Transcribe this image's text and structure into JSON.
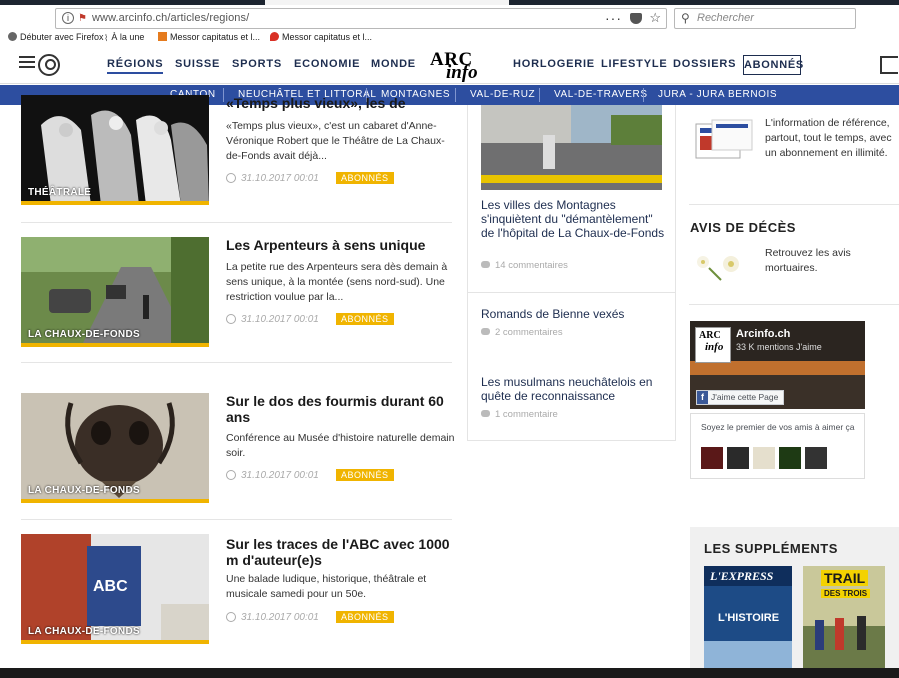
{
  "browser": {
    "url": "www.arcinfo.ch/articles/regions/",
    "search_placeholder": "Rechercher",
    "bookmarks": [
      "Débuter avec Firefox",
      "À la une",
      "Messor capitatus et l...",
      "Messor capitatus et l..."
    ]
  },
  "site": {
    "logo_top": "ARC",
    "logo_bottom": "info",
    "nav": [
      "RÉGIONS",
      "SUISSE",
      "SPORTS",
      "ECONOMIE",
      "MONDE",
      "HORLOGERIE",
      "LIFESTYLE",
      "DOSSIERS"
    ],
    "nav_active": "RÉGIONS",
    "subscribers_label": "ABONNÉS",
    "subnav": [
      "CANTON",
      "NEUCHÂTEL ET LITTORAL",
      "MONTAGNES",
      "VAL-DE-RUZ",
      "VAL-DE-TRAVERS",
      "JURA - JURA BERNOIS"
    ]
  },
  "articles": [
    {
      "tag": "THÉÂTRALE",
      "title": "«Temps plus vieux», les de",
      "excerpt": "«Temps plus vieux», c'est un cabaret d'Anne-Véronique Robert que le Théâtre de La Chaux-de-Fonds avait déjà...",
      "date": "31.10.2017 00:01",
      "badge": "ABONNÉS"
    },
    {
      "tag": "LA CHAUX-DE-FONDS",
      "title": "Les Arpenteurs à sens unique",
      "excerpt": "La petite rue des Arpenteurs sera dès demain à sens unique, à la montée (sens nord-sud). Une restriction voulue par la...",
      "date": "31.10.2017 00:01",
      "badge": "ABONNÉS"
    },
    {
      "tag": "LA CHAUX-DE-FONDS",
      "title": "Sur le dos des fourmis durant 60 ans",
      "excerpt": "Conférence au Musée d'histoire naturelle demain soir.",
      "date": "31.10.2017 00:01",
      "badge": "ABONNÉS"
    },
    {
      "tag": "LA CHAUX-DE-FONDS",
      "title": "Sur les traces de l'ABC avec 1000 m d'auteur(e)s",
      "excerpt": "Une balade ludique, historique, théâtrale et musicale samedi pour un 50e.",
      "date": "31.10.2017 00:01",
      "badge": "ABONNÉS"
    }
  ],
  "most_read": [
    {
      "title": "Les villes des Montagnes s'inquiètent du \"démantèlement\" de l'hôpital de La Chaux-de-Fonds",
      "comments": "14 commentaires"
    },
    {
      "title": "Romands de Bienne vexés",
      "comments": "2 commentaires"
    },
    {
      "title": "Les musulmans neuchâtelois en quête de reconnaissance",
      "comments": "1 commentaire"
    }
  ],
  "sidebar": {
    "promo_text": "L'information de référence, partout, tout le temps, avec un abonnement en illimité.",
    "deaths_heading": "AVIS DE DÉCÈS",
    "deaths_text": "Retrouvez les avis mortuaires.",
    "fb_name": "Arcinfo.ch",
    "fb_likes": "33 K mentions J'aime",
    "fb_like_button": "J'aime cette Page",
    "fb_friends": "Soyez le premier de vos amis à aimer ça",
    "supplements_heading": "LES SUPPLÉMENTS",
    "supp1_title": "L'EXPRESS",
    "supp1_sub": "L'HISTOIRE",
    "supp2_title": "TRAIL",
    "supp2_sub": "DES TROIS"
  },
  "colors": {
    "accent": "#2d4ea0",
    "badge": "#f0b400",
    "nav_text": "#1d2d4f"
  }
}
